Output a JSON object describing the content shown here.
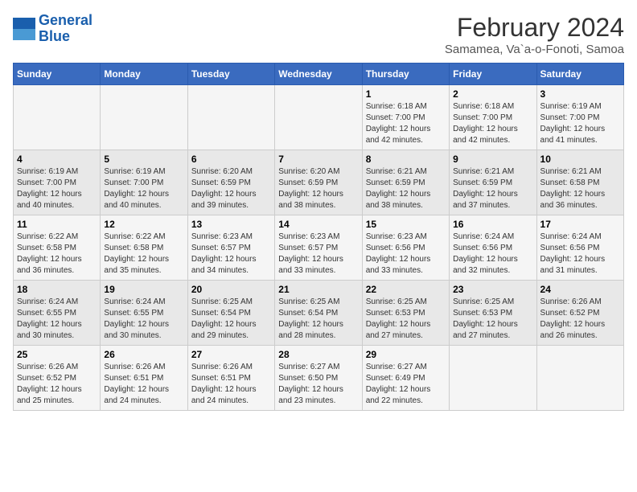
{
  "logo": {
    "line1": "General",
    "line2": "Blue"
  },
  "title": "February 2024",
  "subtitle": "Samamea, Va`a-o-Fonoti, Samoa",
  "weekdays": [
    "Sunday",
    "Monday",
    "Tuesday",
    "Wednesday",
    "Thursday",
    "Friday",
    "Saturday"
  ],
  "weeks": [
    [
      {
        "day": "",
        "info": ""
      },
      {
        "day": "",
        "info": ""
      },
      {
        "day": "",
        "info": ""
      },
      {
        "day": "",
        "info": ""
      },
      {
        "day": "1",
        "info": "Sunrise: 6:18 AM\nSunset: 7:00 PM\nDaylight: 12 hours\nand 42 minutes."
      },
      {
        "day": "2",
        "info": "Sunrise: 6:18 AM\nSunset: 7:00 PM\nDaylight: 12 hours\nand 42 minutes."
      },
      {
        "day": "3",
        "info": "Sunrise: 6:19 AM\nSunset: 7:00 PM\nDaylight: 12 hours\nand 41 minutes."
      }
    ],
    [
      {
        "day": "4",
        "info": "Sunrise: 6:19 AM\nSunset: 7:00 PM\nDaylight: 12 hours\nand 40 minutes."
      },
      {
        "day": "5",
        "info": "Sunrise: 6:19 AM\nSunset: 7:00 PM\nDaylight: 12 hours\nand 40 minutes."
      },
      {
        "day": "6",
        "info": "Sunrise: 6:20 AM\nSunset: 6:59 PM\nDaylight: 12 hours\nand 39 minutes."
      },
      {
        "day": "7",
        "info": "Sunrise: 6:20 AM\nSunset: 6:59 PM\nDaylight: 12 hours\nand 38 minutes."
      },
      {
        "day": "8",
        "info": "Sunrise: 6:21 AM\nSunset: 6:59 PM\nDaylight: 12 hours\nand 38 minutes."
      },
      {
        "day": "9",
        "info": "Sunrise: 6:21 AM\nSunset: 6:59 PM\nDaylight: 12 hours\nand 37 minutes."
      },
      {
        "day": "10",
        "info": "Sunrise: 6:21 AM\nSunset: 6:58 PM\nDaylight: 12 hours\nand 36 minutes."
      }
    ],
    [
      {
        "day": "11",
        "info": "Sunrise: 6:22 AM\nSunset: 6:58 PM\nDaylight: 12 hours\nand 36 minutes."
      },
      {
        "day": "12",
        "info": "Sunrise: 6:22 AM\nSunset: 6:58 PM\nDaylight: 12 hours\nand 35 minutes."
      },
      {
        "day": "13",
        "info": "Sunrise: 6:23 AM\nSunset: 6:57 PM\nDaylight: 12 hours\nand 34 minutes."
      },
      {
        "day": "14",
        "info": "Sunrise: 6:23 AM\nSunset: 6:57 PM\nDaylight: 12 hours\nand 33 minutes."
      },
      {
        "day": "15",
        "info": "Sunrise: 6:23 AM\nSunset: 6:56 PM\nDaylight: 12 hours\nand 33 minutes."
      },
      {
        "day": "16",
        "info": "Sunrise: 6:24 AM\nSunset: 6:56 PM\nDaylight: 12 hours\nand 32 minutes."
      },
      {
        "day": "17",
        "info": "Sunrise: 6:24 AM\nSunset: 6:56 PM\nDaylight: 12 hours\nand 31 minutes."
      }
    ],
    [
      {
        "day": "18",
        "info": "Sunrise: 6:24 AM\nSunset: 6:55 PM\nDaylight: 12 hours\nand 30 minutes."
      },
      {
        "day": "19",
        "info": "Sunrise: 6:24 AM\nSunset: 6:55 PM\nDaylight: 12 hours\nand 30 minutes."
      },
      {
        "day": "20",
        "info": "Sunrise: 6:25 AM\nSunset: 6:54 PM\nDaylight: 12 hours\nand 29 minutes."
      },
      {
        "day": "21",
        "info": "Sunrise: 6:25 AM\nSunset: 6:54 PM\nDaylight: 12 hours\nand 28 minutes."
      },
      {
        "day": "22",
        "info": "Sunrise: 6:25 AM\nSunset: 6:53 PM\nDaylight: 12 hours\nand 27 minutes."
      },
      {
        "day": "23",
        "info": "Sunrise: 6:25 AM\nSunset: 6:53 PM\nDaylight: 12 hours\nand 27 minutes."
      },
      {
        "day": "24",
        "info": "Sunrise: 6:26 AM\nSunset: 6:52 PM\nDaylight: 12 hours\nand 26 minutes."
      }
    ],
    [
      {
        "day": "25",
        "info": "Sunrise: 6:26 AM\nSunset: 6:52 PM\nDaylight: 12 hours\nand 25 minutes."
      },
      {
        "day": "26",
        "info": "Sunrise: 6:26 AM\nSunset: 6:51 PM\nDaylight: 12 hours\nand 24 minutes."
      },
      {
        "day": "27",
        "info": "Sunrise: 6:26 AM\nSunset: 6:51 PM\nDaylight: 12 hours\nand 24 minutes."
      },
      {
        "day": "28",
        "info": "Sunrise: 6:27 AM\nSunset: 6:50 PM\nDaylight: 12 hours\nand 23 minutes."
      },
      {
        "day": "29",
        "info": "Sunrise: 6:27 AM\nSunset: 6:49 PM\nDaylight: 12 hours\nand 22 minutes."
      },
      {
        "day": "",
        "info": ""
      },
      {
        "day": "",
        "info": ""
      }
    ]
  ]
}
